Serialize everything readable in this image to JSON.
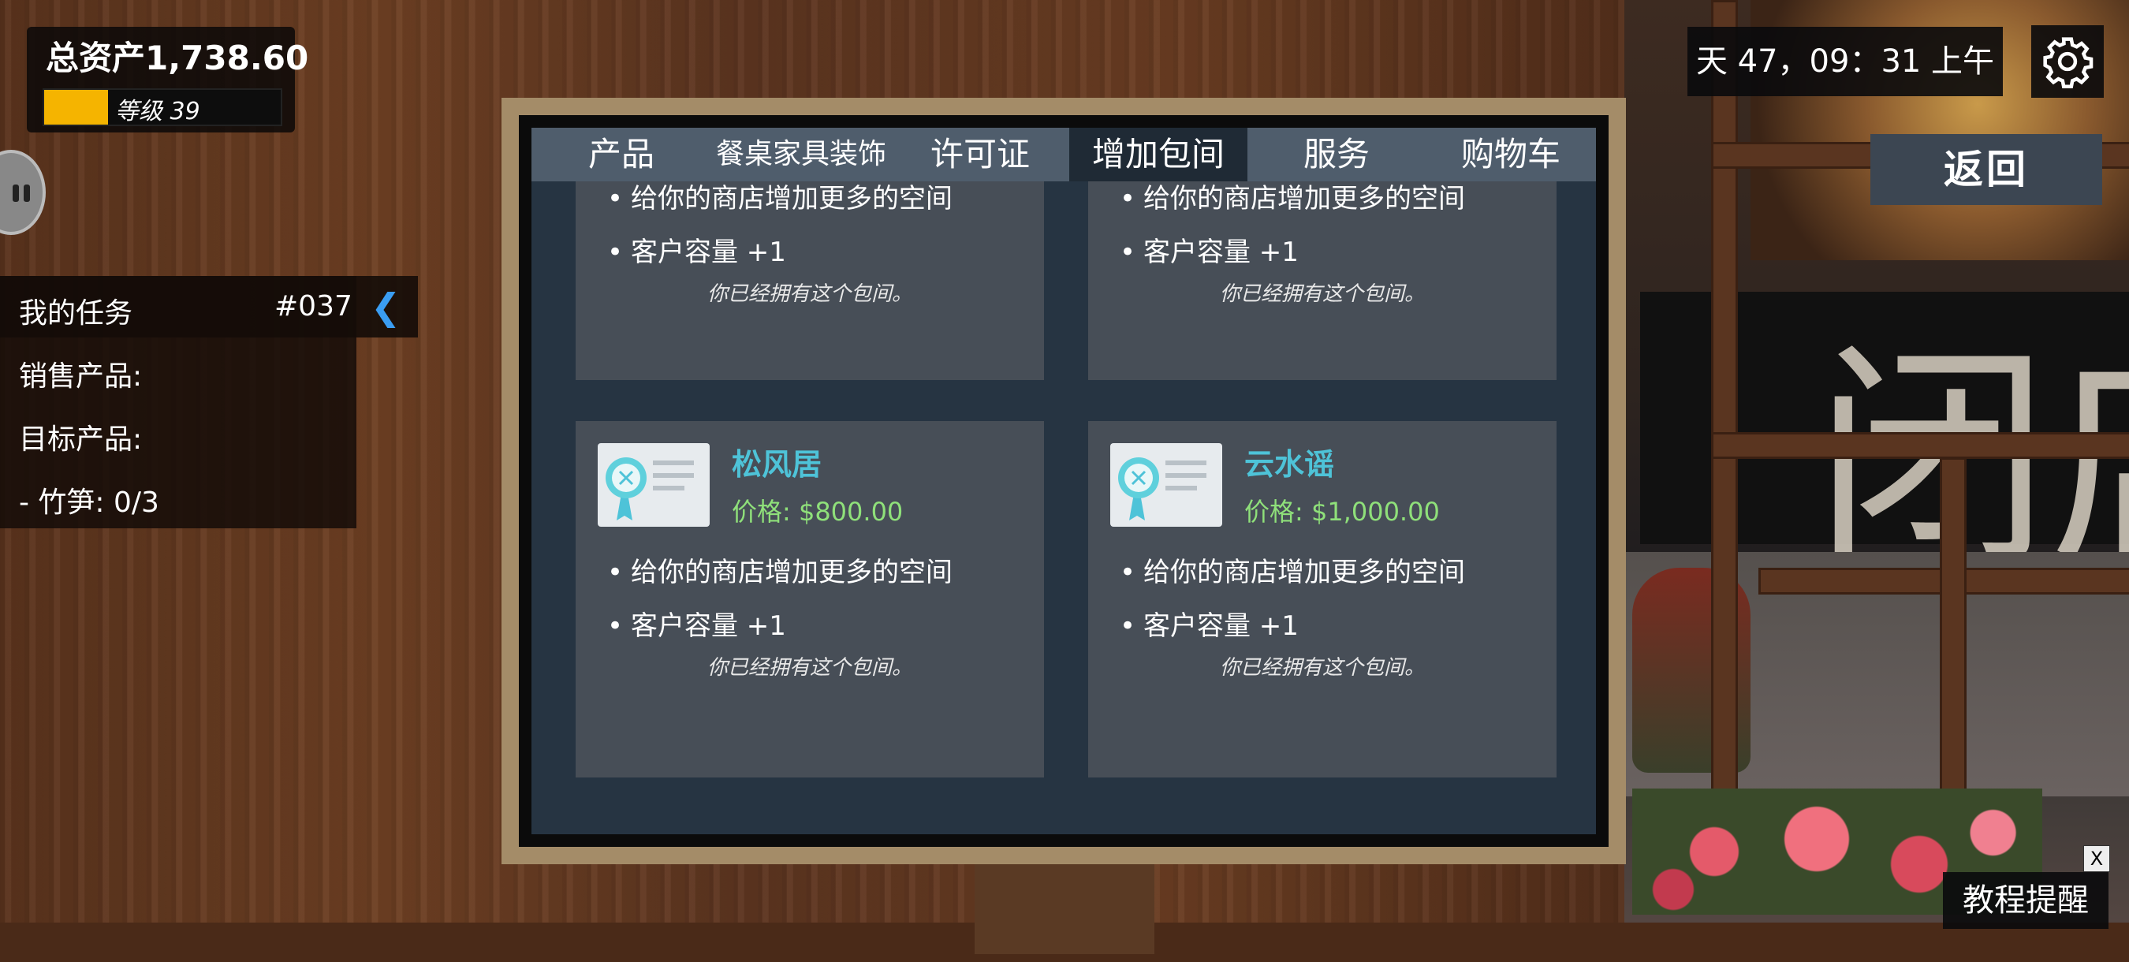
{
  "hud": {
    "total_assets": "总资产1,738.60",
    "level_label": "等级 39",
    "level_progress": 0.27,
    "clock": "天 47，09：31 上午",
    "back_label": "返回",
    "tutorial_label": "教程提醒",
    "tutorial_close": "X"
  },
  "tasks": {
    "title": "我的任务",
    "number": "#037",
    "sell_label": "销售产品:",
    "target_label": "目标产品:",
    "target_item": "- 竹笋: 0/3"
  },
  "tabs": [
    {
      "label": "产品"
    },
    {
      "label": "餐桌家具装饰"
    },
    {
      "label": "许可证"
    },
    {
      "label": "增加包间"
    },
    {
      "label": "服务"
    },
    {
      "label": "购物车"
    }
  ],
  "rooms": [
    {
      "feature1": "给你的商店增加更多的空间",
      "feature2": "客户容量 +1",
      "owned": "你已经拥有这个包间。"
    },
    {
      "feature1": "给你的商店增加更多的空间",
      "feature2": "客户容量 +1",
      "owned": "你已经拥有这个包间。"
    },
    {
      "name": "松风居",
      "price": "价格: $800.00",
      "feature1": "给你的商店增加更多的空间",
      "feature2": "客户容量 +1",
      "owned": "你已经拥有这个包间。"
    },
    {
      "name": "云水谣",
      "price": "价格: $1,000.00",
      "feature1": "给你的商店增加更多的空间",
      "feature2": "客户容量 +1",
      "owned": "你已经拥有这个包间。"
    }
  ],
  "colors": {
    "level_fill": "#f5b400",
    "room_name": "#4ec3d8",
    "price": "#8fe07a",
    "active_tab": "#1f2a35",
    "tab_bar": "#4f5d6c"
  },
  "scene_sign_glyph": "闭店"
}
